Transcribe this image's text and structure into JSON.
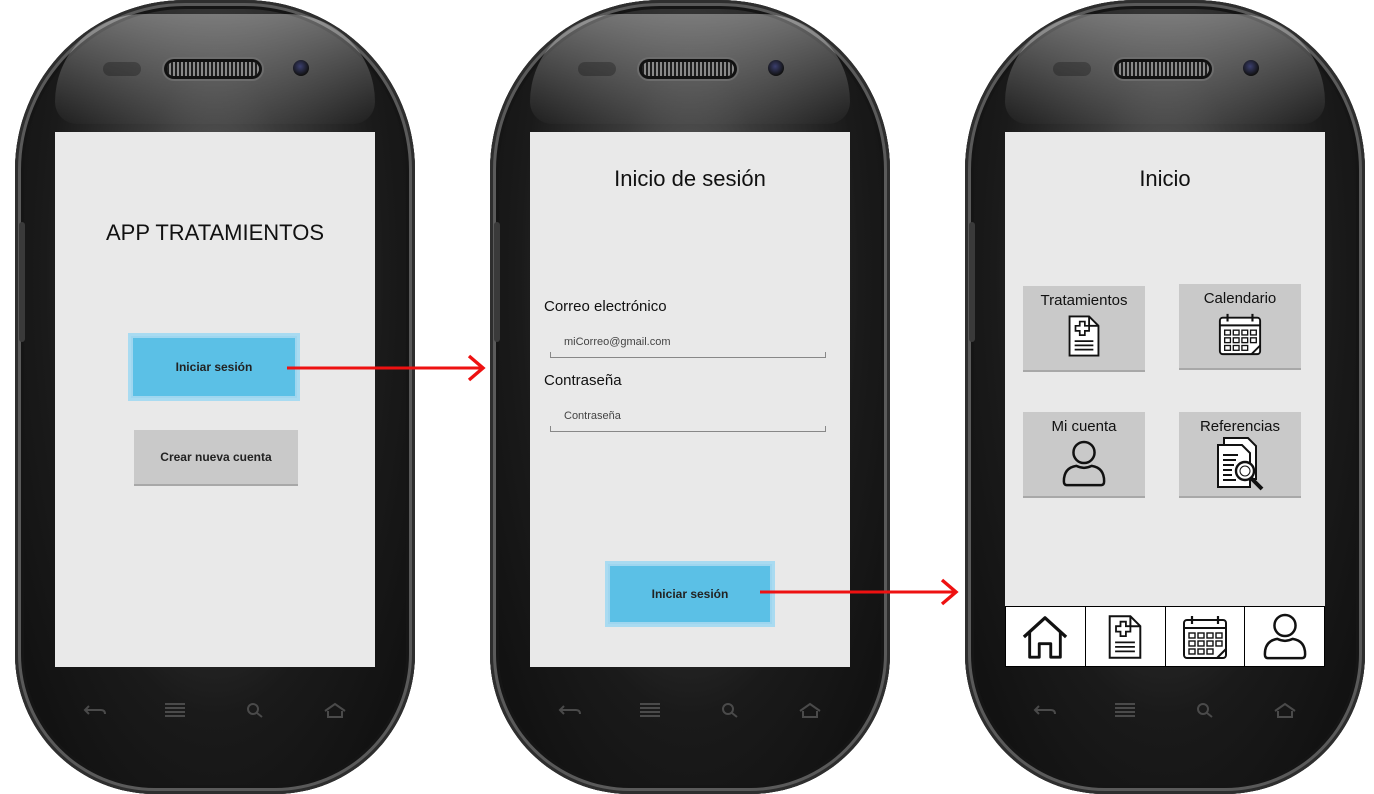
{
  "screen1": {
    "title": "APP TRATAMIENTOS",
    "login_button": "Iniciar sesión",
    "create_button": "Crear nueva cuenta"
  },
  "screen2": {
    "title": "Inicio de sesión",
    "email_label": "Correo electrónico",
    "email_value": "miCorreo@gmail.com",
    "password_label": "Contraseña",
    "password_value": "Contraseña",
    "login_button": "Iniciar sesión"
  },
  "screen3": {
    "title": "Inicio",
    "tiles": [
      {
        "label": "Tratamientos",
        "icon": "medical-document-icon"
      },
      {
        "label": "Calendario",
        "icon": "calendar-icon"
      },
      {
        "label": "Mi cuenta",
        "icon": "user-icon"
      },
      {
        "label": "Referencias",
        "icon": "document-search-icon"
      }
    ],
    "tabbar": [
      {
        "icon": "home-icon"
      },
      {
        "icon": "medical-document-icon"
      },
      {
        "icon": "calendar-icon"
      },
      {
        "icon": "user-icon"
      }
    ]
  },
  "colors": {
    "primary_button": "#5bc0e6",
    "secondary_button": "#c9c9c9",
    "screen_background": "#e9e9e9",
    "flow_arrow": "#ee1111"
  }
}
